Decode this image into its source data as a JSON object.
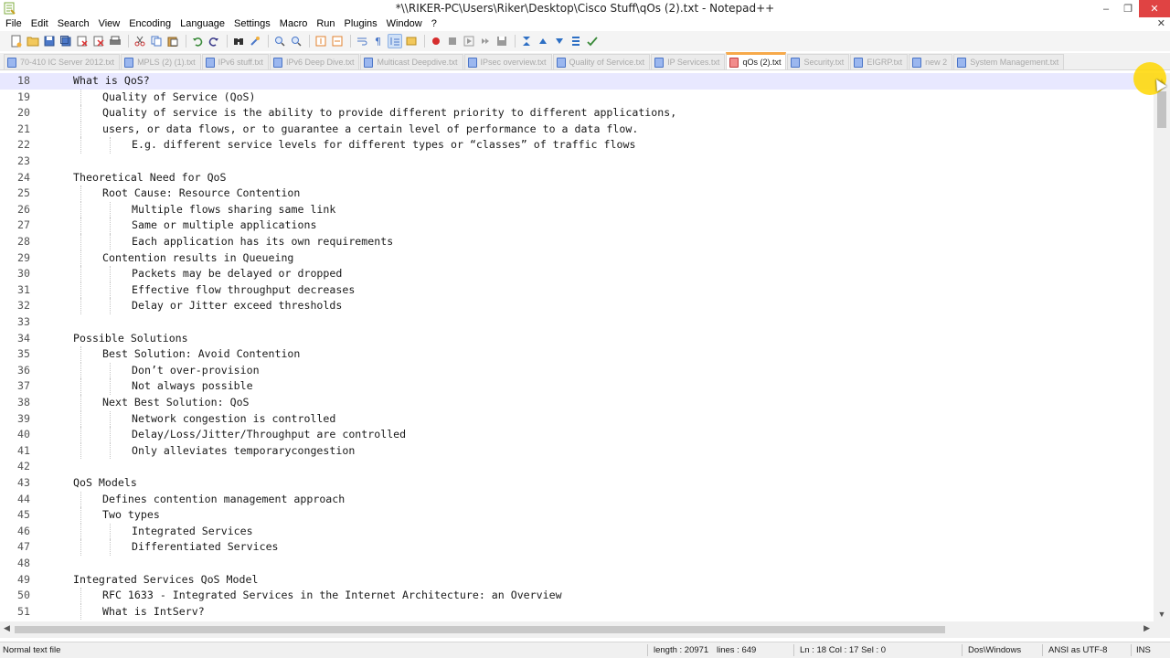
{
  "window": {
    "title": "*\\\\RIKER-PC\\Users\\Riker\\Desktop\\Cisco Stuff\\qOs (2).txt - Notepad++",
    "minimize": "–",
    "maximize": "❐",
    "close": "✕"
  },
  "menu": {
    "items": [
      "File",
      "Edit",
      "Search",
      "View",
      "Encoding",
      "Language",
      "Settings",
      "Macro",
      "Run",
      "Plugins",
      "Window",
      "?"
    ],
    "close_doc": "✕"
  },
  "tabs": [
    {
      "label": "70-410 IC Server 2012.txt",
      "active": false
    },
    {
      "label": "MPLS (2) (1).txt",
      "active": false
    },
    {
      "label": "IPv6 stuff.txt",
      "active": false
    },
    {
      "label": "IPv6 Deep Dive.txt",
      "active": false
    },
    {
      "label": "Multicast Deepdive.txt",
      "active": false
    },
    {
      "label": "IPsec overview.txt",
      "active": false
    },
    {
      "label": "Quality of Service.txt",
      "active": false
    },
    {
      "label": "IP Services.txt",
      "active": false
    },
    {
      "label": "qOs (2).txt",
      "active": true
    },
    {
      "label": "Security.txt",
      "active": false
    },
    {
      "label": "EIGRP.txt",
      "active": false
    },
    {
      "label": "new 2",
      "active": false
    },
    {
      "label": "System Management.txt",
      "active": false
    }
  ],
  "editor": {
    "lines": [
      {
        "num": "18",
        "text": "What is QoS?",
        "indent": 0,
        "current": true
      },
      {
        "num": "19",
        "text": "Quality of Service (QoS)",
        "indent": 1
      },
      {
        "num": "20",
        "text": "Quality of service is the ability to provide different priority to different applications,",
        "indent": 1
      },
      {
        "num": "21",
        "text": "users, or data flows, or to guarantee a certain level of performance to a data flow.",
        "indent": 1
      },
      {
        "num": "22",
        "text": "E.g. different service levels for different types or “classes” of traffic flows",
        "indent": 2
      },
      {
        "num": "23",
        "text": "",
        "indent": 0
      },
      {
        "num": "24",
        "text": "Theoretical Need for QoS",
        "indent": 0
      },
      {
        "num": "25",
        "text": "Root Cause: Resource Contention",
        "indent": 1
      },
      {
        "num": "26",
        "text": "Multiple flows sharing same link",
        "indent": 2
      },
      {
        "num": "27",
        "text": "Same or multiple applications",
        "indent": 2
      },
      {
        "num": "28",
        "text": "Each application has its own requirements",
        "indent": 2
      },
      {
        "num": "29",
        "text": "Contention results in Queueing",
        "indent": 1
      },
      {
        "num": "30",
        "text": "Packets may be delayed or dropped",
        "indent": 2
      },
      {
        "num": "31",
        "text": "Effective flow throughput decreases",
        "indent": 2
      },
      {
        "num": "32",
        "text": "Delay or Jitter exceed thresholds",
        "indent": 2
      },
      {
        "num": "33",
        "text": "",
        "indent": 0
      },
      {
        "num": "34",
        "text": "Possible Solutions",
        "indent": 0
      },
      {
        "num": "35",
        "text": "Best Solution: Avoid Contention",
        "indent": 1
      },
      {
        "num": "36",
        "text": "Don’t over-provision",
        "indent": 2
      },
      {
        "num": "37",
        "text": "Not always possible",
        "indent": 2
      },
      {
        "num": "38",
        "text": "Next Best Solution: QoS",
        "indent": 1
      },
      {
        "num": "39",
        "text": "Network congestion is controlled",
        "indent": 2
      },
      {
        "num": "40",
        "text": "Delay/Loss/Jitter/Throughput are controlled",
        "indent": 2
      },
      {
        "num": "41",
        "text": "Only alleviates temporarycongestion",
        "indent": 2
      },
      {
        "num": "42",
        "text": "",
        "indent": 0
      },
      {
        "num": "43",
        "text": "QoS Models",
        "indent": 0
      },
      {
        "num": "44",
        "text": "Defines contention management approach",
        "indent": 1
      },
      {
        "num": "45",
        "text": "Two types",
        "indent": 1
      },
      {
        "num": "46",
        "text": "Integrated Services",
        "indent": 2
      },
      {
        "num": "47",
        "text": "Differentiated Services",
        "indent": 2
      },
      {
        "num": "48",
        "text": "",
        "indent": 0
      },
      {
        "num": "49",
        "text": "Integrated Services QoS Model",
        "indent": 0
      },
      {
        "num": "50",
        "text": "RFC 1633 - Integrated Services in the Internet Architecture: an Overview",
        "indent": 1
      },
      {
        "num": "51",
        "text": "What is IntServ?",
        "indent": 1
      }
    ]
  },
  "statusbar": {
    "file_type": "Normal text file",
    "length": "length : 20971",
    "lines": "lines : 649",
    "position": "Ln : 18    Col : 17    Sel : 0",
    "eol": "Dos\\Windows",
    "encoding": "ANSI as UTF-8",
    "mode": "INS"
  },
  "colors": {
    "current_line": "#e8e8ff",
    "active_tab_accent": "#f7a94a",
    "cursor_highlight": "#ffd700"
  }
}
